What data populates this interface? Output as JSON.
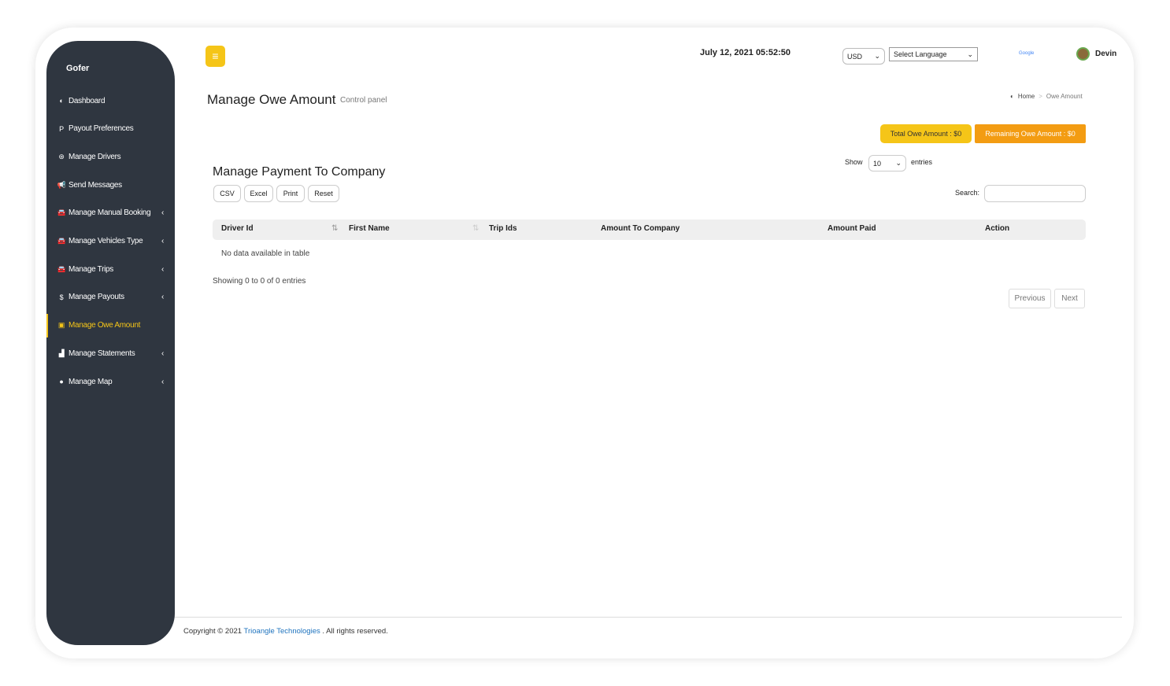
{
  "brand": "Gofer",
  "sidebar": {
    "items": [
      {
        "label": "Dashboard",
        "icon": "dashboard-icon",
        "glyph": "◐"
      },
      {
        "label": "Payout Preferences",
        "icon": "paypal-icon",
        "glyph": "P"
      },
      {
        "label": "Manage Drivers",
        "icon": "steering-wheel-icon",
        "glyph": "⊛"
      },
      {
        "label": "Send Messages",
        "icon": "bullhorn-icon",
        "glyph": "📢"
      },
      {
        "label": "Manage Manual Booking",
        "icon": "car-icon",
        "glyph": "🚘",
        "chevron": "‹"
      },
      {
        "label": "Manage Vehicles Type",
        "icon": "car-icon",
        "glyph": "🚘",
        "chevron": "‹"
      },
      {
        "label": "Manage Trips",
        "icon": "car-icon",
        "glyph": "🚘",
        "chevron": "‹"
      },
      {
        "label": "Manage Payouts",
        "icon": "dollar-icon",
        "glyph": "$",
        "chevron": "‹"
      },
      {
        "label": "Manage Owe Amount",
        "icon": "money-icon",
        "glyph": "▣",
        "active": true
      },
      {
        "label": "Manage Statements",
        "icon": "area-chart-icon",
        "glyph": "▟",
        "chevron": "‹"
      },
      {
        "label": "Manage Map",
        "icon": "map-marker-icon",
        "glyph": "●",
        "chevron": "‹"
      }
    ]
  },
  "header": {
    "datetime": "July 12, 2021 05:52:50",
    "currency": "USD",
    "language": "Select Language",
    "google": "Google",
    "user": "Devin"
  },
  "page": {
    "title": "Manage Owe Amount",
    "subtitle": "Control panel",
    "breadcrumb": {
      "home": "Home",
      "sep": ">",
      "current": "Owe Amount"
    },
    "total_owe": "Total Owe Amount : $0",
    "remaining_owe": "Remaining Owe Amount : $0"
  },
  "table": {
    "title": "Manage Payment To Company",
    "buttons": [
      "CSV",
      "Excel",
      "Print",
      "Reset"
    ],
    "show_label": "Show",
    "entries_value": "10",
    "entries_label": "entries",
    "search_label": "Search:",
    "search_value": "",
    "columns": [
      "Driver Id",
      "First Name",
      "Trip Ids",
      "Amount To Company",
      "Amount Paid",
      "Action"
    ],
    "empty": "No data available in table",
    "info": "Showing 0 to 0 of 0 entries",
    "previous": "Previous",
    "next": "Next"
  },
  "footer": {
    "prefix": "Copyright © 2021",
    "company": "Trioangle Technologies",
    "suffix": ". All rights reserved."
  },
  "colors": {
    "sidebar": "#2f3640",
    "accent": "#f5c518",
    "orange": "#f39c12",
    "link": "#1e73be"
  }
}
